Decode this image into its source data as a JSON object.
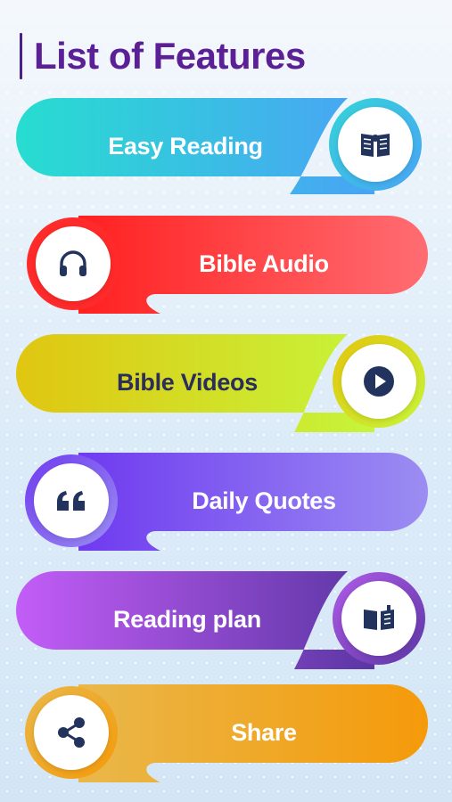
{
  "header": {
    "title": "List of Features"
  },
  "features": [
    {
      "label": "Easy Reading",
      "icon": "open-book-reader-icon",
      "text_color": "#ffffff",
      "from": "#27ddd0",
      "to": "#4aa3f5"
    },
    {
      "label": "Bible Audio",
      "icon": "headphones-icon",
      "text_color": "#ffffff",
      "from": "#ff2020",
      "to": "#ff6d72"
    },
    {
      "label": "Bible Videos",
      "icon": "play-circle-icon",
      "text_color": "#2b2d5a",
      "from": "#e0c611",
      "to": "#c6f53a"
    },
    {
      "label": "Daily Quotes",
      "icon": "quote-icon",
      "text_color": "#ffffff",
      "from": "#6f3af0",
      "to": "#9b8df2"
    },
    {
      "label": "Reading plan",
      "icon": "open-book-icon",
      "text_color": "#ffffff",
      "from": "#c35df7",
      "to": "#5b36a4"
    },
    {
      "label": "Share",
      "icon": "share-icon",
      "text_color": "#ffffff",
      "from": "#e9b84a",
      "to": "#f59a0a"
    }
  ]
}
